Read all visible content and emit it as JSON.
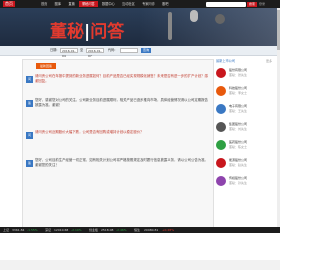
{
  "header": {
    "logo": "首页",
    "nav": [
      "首页",
      "图库",
      "直播",
      "董秘问答",
      "数据中心",
      "互动社区",
      "专家问诊",
      "股吧"
    ],
    "active_nav": 3,
    "search_button": "搜索",
    "links": "登录"
  },
  "banner": {
    "title_left": "董秘",
    "title_right": "问答"
  },
  "filter": {
    "date_label": "日期:",
    "start_date": "2016-01-04",
    "to_label": "至",
    "end_date": "2016-01-07",
    "code_label": "代码:",
    "code_placeholder": "",
    "search_label": "查询"
  },
  "main": {
    "tag": "最新回答",
    "items": [
      {
        "num": "问",
        "text": "请问贵公司在年报中提到的新业务进展如何？目前产品是否已经实现规模化销售？未来是否有进一步的扩产计划？感谢回复。"
      },
      {
        "num": "答",
        "text": "您好，感谢您对公司的关注。公司新业务目前进展顺利，相关产品已逐步推向市场，具体经营情况请以公司定期报告披露为准。谢谢！"
      },
      {
        "num": "问",
        "text": "请问贵公司近期股价大幅下跌，公司是否有回购或增持计划以稳定股价？"
      },
      {
        "num": "答",
        "text": "您好，公司目前生产经营一切正常，如有相关计划公司将严格按照规定及时履行信息披露义务，请以公司公告为准。谢谢您的关注！"
      }
    ]
  },
  "side": {
    "title": "最新上市公司",
    "more": "更多",
    "items": [
      {
        "name": "股份有限公司",
        "sub": "董秘：张先生"
      },
      {
        "name": "科技股份公司",
        "sub": "董秘：李女士"
      },
      {
        "name": "电子有限公司",
        "sub": "董秘：王先生"
      },
      {
        "name": "集团股份公司",
        "sub": "董秘：刘先生"
      },
      {
        "name": "医药股份公司",
        "sub": "董秘：陈女士"
      },
      {
        "name": "能源股份公司",
        "sub": "董秘：赵先生"
      },
      {
        "name": "传媒股份公司",
        "sub": "董秘：孙先生"
      }
    ]
  },
  "ticker": {
    "items": [
      "上证",
      "3361.84",
      "-1.55%",
      "深证",
      "12010.68",
      "-2.10%",
      "创业板",
      "2518.08",
      "-2.46%",
      "恒生",
      "20980.81",
      "+0.28%"
    ]
  },
  "colors": {
    "brand": "#c8161d",
    "accent": "#3a78c3",
    "question": "#c0392b"
  },
  "icons": [
    "logo-icon",
    "search-icon",
    "company-logo-icon"
  ]
}
